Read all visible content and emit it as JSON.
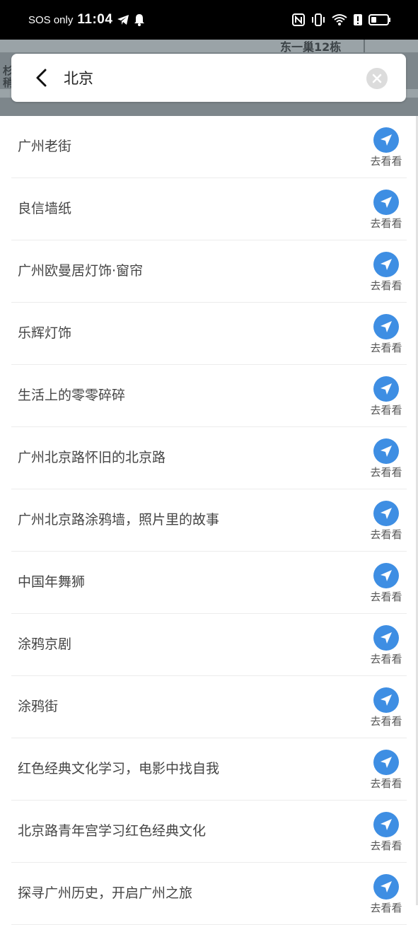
{
  "status_bar": {
    "carrier": "SOS only",
    "time": "11:04"
  },
  "map": {
    "label_top": "东一巢12栋",
    "label_left": "杉\n稍"
  },
  "search": {
    "query": "北京"
  },
  "go_label": "去看看",
  "results": [
    "广州老街",
    "良信墙纸",
    "广州欧曼居灯饰·窗帘",
    "乐辉灯饰",
    "生活上的零零碎碎",
    "广州北京路怀旧的北京路",
    "广州北京路涂鸦墙，照片里的故事",
    "中国年舞狮",
    "涂鸦京剧",
    "涂鸦街",
    "红色经典文化学习，电影中找自我",
    "北京路青年宫学习红色经典文化",
    "探寻广州历史，开启广州之旅"
  ],
  "colors": {
    "accent": "#3e8ee3",
    "status_bar_bg": "#000000"
  }
}
